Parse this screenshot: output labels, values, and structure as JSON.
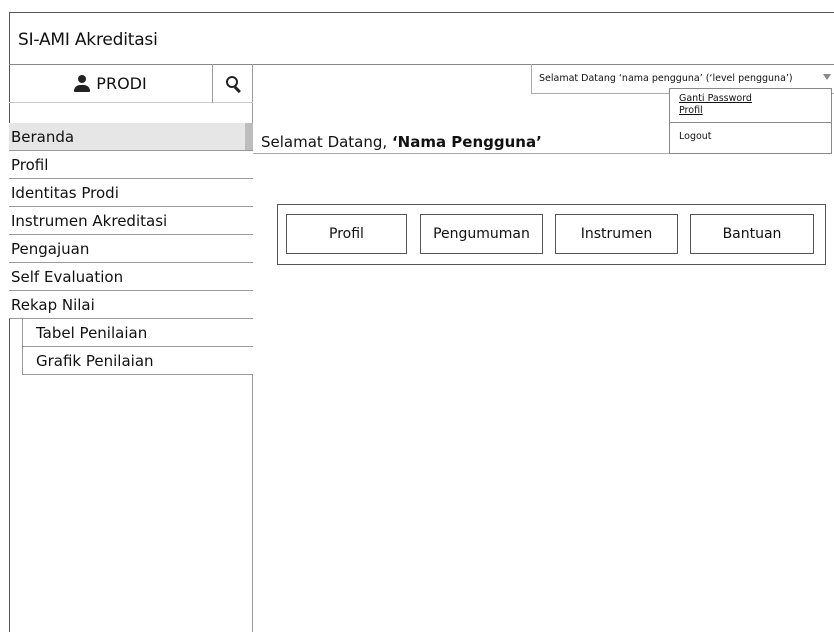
{
  "app": {
    "title": "SI-AMI Akreditasi"
  },
  "sidebar": {
    "role_label": "PRODI",
    "items": [
      {
        "label": "Beranda",
        "active": true
      },
      {
        "label": "Profil"
      },
      {
        "label": "Identitas Prodi"
      },
      {
        "label": "Instrumen Akreditasi"
      },
      {
        "label": "Pengajuan"
      },
      {
        "label": "Self Evaluation"
      },
      {
        "label": "Rekap Nilai"
      }
    ],
    "subitems": [
      {
        "label": "Tabel Penilaian"
      },
      {
        "label": "Grafik Penilaian"
      }
    ]
  },
  "header": {
    "welcome": "Selamat Datang ‘nama pengguna’ (‘level pengguna’)"
  },
  "user_menu": {
    "change_password": "Ganti Password",
    "profile": "Profil",
    "logout": "Logout"
  },
  "main": {
    "welcome_prefix": "Selamat Datang, ",
    "welcome_name": "‘Nama Pengguna’",
    "buttons": [
      "Profil",
      "Pengumuman",
      "Instrumen",
      "Bantuan"
    ]
  }
}
